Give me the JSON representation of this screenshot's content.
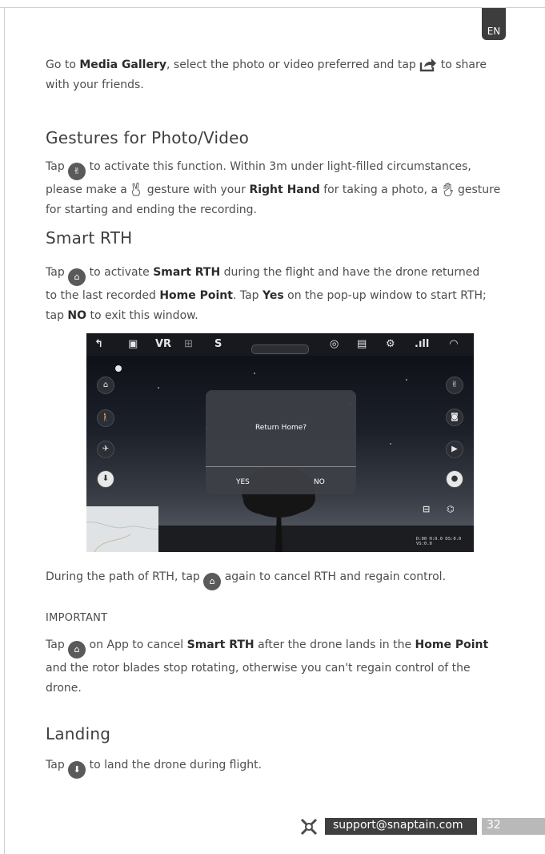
{
  "badge": "EN",
  "share_para": {
    "t1": "Go to ",
    "b1": "Media Gallery",
    "t2": ", select the photo or video preferred and tap ",
    "t3": " to share",
    "line2": "with your friends."
  },
  "gestures": {
    "heading": "Gestures for Photo/Video",
    "t1": "Tap ",
    "t2": " to activate this function. Within 3m under light-filled circumstances,",
    "t3": "please make a ",
    "t4": " gesture with your ",
    "b1": "Right Hand",
    "t5": " for taking a photo, a ",
    "t6": " gesture",
    "line3": "for starting and ending the recording."
  },
  "smart_rth": {
    "heading": "Smart RTH",
    "t1": "Tap ",
    "t2": " to activate ",
    "b1": "Smart RTH",
    "t3": " during the flight and have the drone returned",
    "t4": "to the last recorded ",
    "b2": "Home Point",
    "t5": ". Tap ",
    "b3": "Yes",
    "t6": " on the pop-up window to start RTH;",
    "t7": "tap ",
    "b4": "NO",
    "t8": " to exit this window."
  },
  "screenshot": {
    "dialog_title": "Return Home?",
    "yes": "YES",
    "no": "NO",
    "telemetry": "D:00 H:0.0 DS:0.0 VS:0.0",
    "topbar_icons": [
      "back-icon",
      "gallery-icon",
      "vr-icon",
      "gamepad-icon",
      "trajectory-icon",
      "360-icon",
      "checklist-icon",
      "settings-icon",
      "signal-icon",
      "wifi-icon"
    ]
  },
  "during_rth": {
    "t1": "During the path of RTH, tap ",
    "t2": " again to cancel RTH and regain control."
  },
  "important": {
    "label": "IMPORTANT",
    "t1": "Tap ",
    "t2": " on App to cancel ",
    "b1": "Smart RTH",
    "t3": " after the drone lands in the ",
    "b2": "Home Point",
    "line2": "and the rotor blades stop rotating, otherwise you can't regain control of the",
    "line3": "drone."
  },
  "landing": {
    "heading": "Landing",
    "t1": "Tap ",
    "t2": " to land the drone during flight."
  },
  "footer": {
    "email": "support@snaptain.com",
    "page": "32"
  }
}
